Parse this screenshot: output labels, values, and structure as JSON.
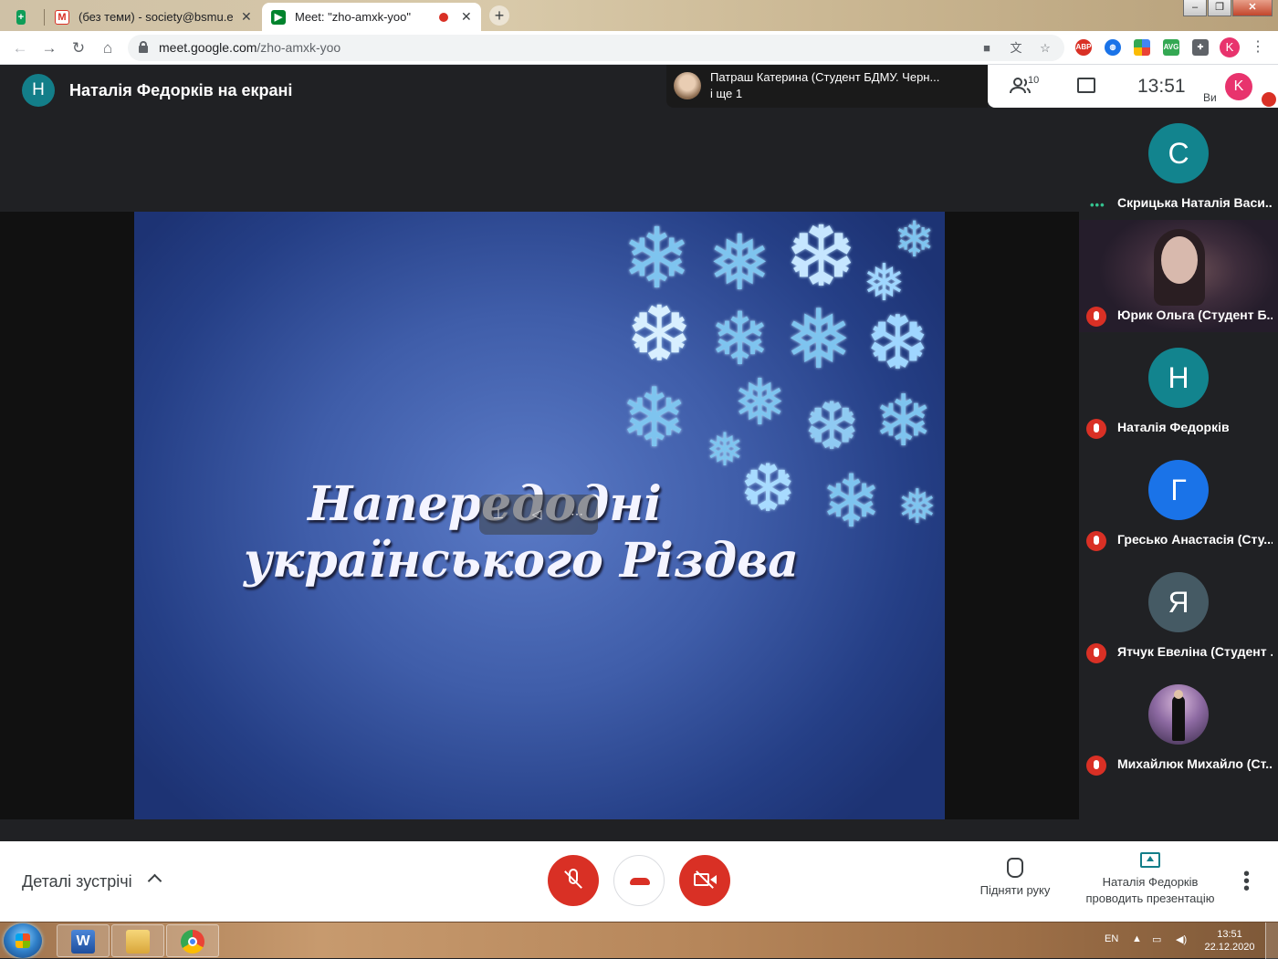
{
  "browser": {
    "tabs": [
      {
        "title": "",
        "favicon": "sheets-icon",
        "color": "#0f9d58"
      },
      {
        "title": "(без теми) - society@bsmu.edu.u",
        "favicon": "gmail-icon",
        "color": "#d93025"
      },
      {
        "title": "Meet: \"zho-amxk-yoo\"",
        "favicon": "meet-icon",
        "color": "#00832d",
        "active": true
      }
    ],
    "url_host": "meet.google.com",
    "url_path": "/zho-amxk-yoo",
    "profile_initial": "K",
    "extensions": [
      "adblock-icon",
      "translate-icon",
      "avg-icon",
      "puzzle-icon"
    ]
  },
  "meet": {
    "presenter_initial": "Н",
    "presenter_title": "Наталія Федорків на екрані",
    "speaker_name": "Патраш Катерина (Студент БДМУ. Черн...",
    "speaker_more": "і ще 1",
    "participants_count": "10",
    "clock": "13:51",
    "you_label": "Ви",
    "you_initial": "K",
    "slide": {
      "line1": "Напередодні",
      "line2": "українського Різдва"
    },
    "participants": [
      {
        "initial": "С",
        "name": "Скрицька Наталія Васи...",
        "color": "#12848e",
        "status": "speaking"
      },
      {
        "initial": "",
        "name": "Юрик Ольга (Студент Б...",
        "color": "",
        "status": "muted",
        "photo": true
      },
      {
        "initial": "Н",
        "name": "Наталія Федорків",
        "color": "#12848e",
        "status": "muted"
      },
      {
        "initial": "Г",
        "name": "Гресько Анастасія (Сту...",
        "color": "#1a73e8",
        "status": "muted"
      },
      {
        "initial": "Я",
        "name": "Ятчук Евеліна (Студент ...",
        "color": "#455a64",
        "status": "muted"
      },
      {
        "initial": "",
        "name": "Михайлюк Михайло (Ст...",
        "color": "",
        "status": "muted",
        "photo": true
      }
    ],
    "controls": {
      "details_label": "Деталі зустрічі",
      "raise_hand_label": "Підняти руку",
      "presenting_line1": "Наталія Федорків",
      "presenting_line2": "проводить презентацію"
    }
  },
  "taskbar": {
    "lang": "EN",
    "time": "13:51",
    "date": "22.12.2020",
    "apps": [
      "word-icon",
      "explorer-icon",
      "chrome-icon"
    ]
  }
}
